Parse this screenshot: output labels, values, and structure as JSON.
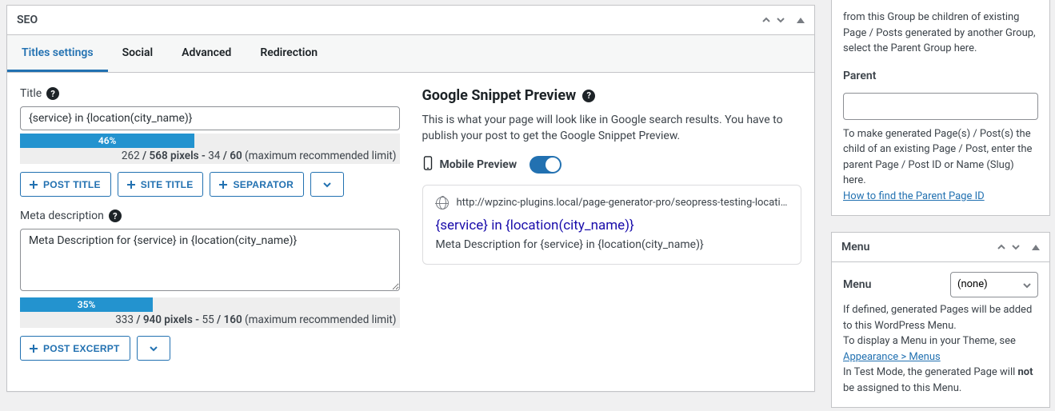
{
  "panel": {
    "title": "SEO"
  },
  "tabs": {
    "titles": "Titles settings",
    "social": "Social",
    "advanced": "Advanced",
    "redirection": "Redirection"
  },
  "title_field": {
    "label": "Title",
    "value": "{service} in {location(city_name)}",
    "progress_percent": "46%",
    "progress_width": "46%",
    "limit_pixels_current": "262",
    "limit_pixels_max": "568",
    "limit_chars_current": "34",
    "limit_chars_max": "60",
    "limit_suffix": "(maximum recommended limit)"
  },
  "meta_field": {
    "label": "Meta description",
    "value": "Meta Description for {service} in {location(city_name)}",
    "progress_percent": "35%",
    "progress_width": "35%",
    "limit_pixels_current": "333",
    "limit_pixels_max": "940",
    "limit_chars_current": "55",
    "limit_chars_max": "160",
    "limit_suffix": "(maximum recommended limit)"
  },
  "buttons": {
    "post_title": "POST TITLE",
    "site_title": "SITE TITLE",
    "separator": "SEPARATOR",
    "post_excerpt": "POST EXCERPT"
  },
  "preview": {
    "heading": "Google Snippet Preview",
    "desc": "This is what your page will look like in Google search results. You have to publish your post to get the Google Snippet Preview.",
    "mobile_label": "Mobile Preview",
    "url": "http://wpzinc-plugins.local/page-generator-pro/seopress-testing-locationcity…",
    "title": "{service} in {location(city_name)}",
    "meta": "Meta Description for {service} in {location(city_name)}"
  },
  "sidebar": {
    "group_fragment": "from this Group be children of existing Page / Posts generated by another Group, select the Parent Group here.",
    "parent_label": "Parent",
    "parent_help1": "To make generated Page(s) / Post(s) the child of an existing Page / Post, enter the parent Page / Post ID or Name (Slug) here.",
    "parent_link": "How to find the Parent Page ID",
    "menu_title": "Menu",
    "menu_label": "Menu",
    "menu_value": "(none)",
    "menu_help1": "If defined, generated Pages will be added to this WordPress Menu.",
    "menu_help2a": "To display a Menu in your Theme, see ",
    "menu_link": "Appearance > Menus",
    "menu_help3a": "In Test Mode, the generated Page will ",
    "menu_help3b": "not",
    "menu_help3c": " be assigned to this Menu."
  }
}
